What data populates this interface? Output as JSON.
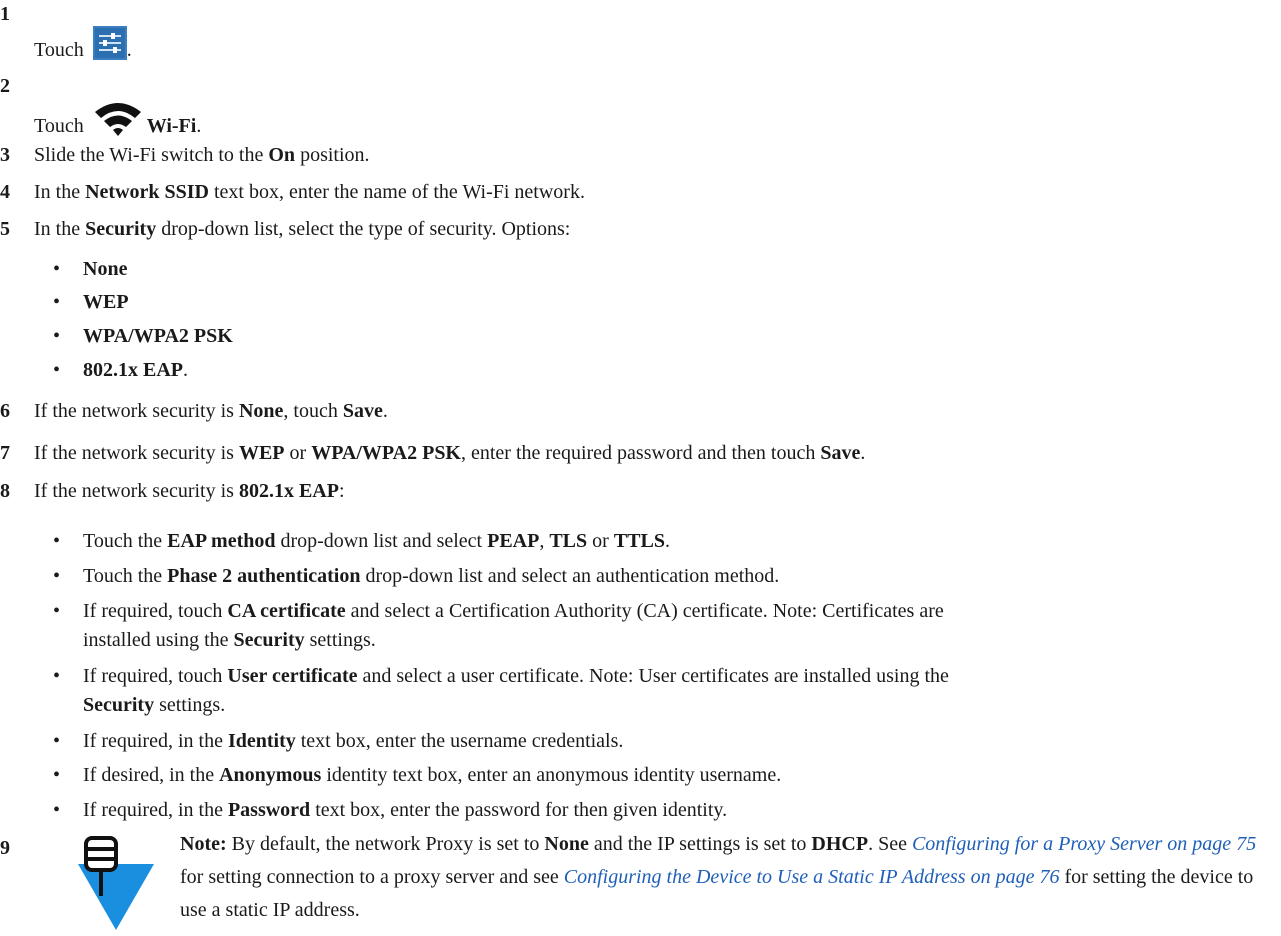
{
  "steps": [
    {
      "num": "1",
      "pre": "Touch",
      "post": ".",
      "icon": "settings-icon"
    },
    {
      "num": "2",
      "pre": "Touch",
      "bold": "Wi-Fi",
      "post": ".",
      "icon": "wifi-icon"
    },
    {
      "num": "3",
      "parts": [
        "Slide the Wi-Fi switch to the ",
        "On",
        " position."
      ]
    },
    {
      "num": "4",
      "parts": [
        "In the ",
        "Network SSID",
        " text box, enter the name of the Wi-Fi network."
      ]
    },
    {
      "num": "5",
      "parts": [
        "In the ",
        "Security",
        " drop-down list, select the type of security. Options:"
      ]
    },
    {
      "num": "6",
      "parts": [
        "If the network security is ",
        "None",
        ", touch ",
        "Save",
        "."
      ]
    },
    {
      "num": "7",
      "parts": [
        "If the network security is ",
        "WEP",
        " or ",
        "WPA/WPA2 PSK",
        ", enter the required password and then touch ",
        "Save",
        "."
      ]
    },
    {
      "num": "8",
      "parts": [
        "If the network security is ",
        "802.1x EAP",
        ":"
      ]
    },
    {
      "num": "9"
    }
  ],
  "security_options": [
    "None",
    "WEP",
    "WPA/WPA2 PSK",
    "802.1x EAP"
  ],
  "security_options_last_suffix": ".",
  "eap_bullets": [
    {
      "l1": [
        "Touch the ",
        "EAP method",
        " drop-down list and select ",
        "PEAP",
        ", ",
        "TLS",
        " or ",
        "TTLS",
        "."
      ]
    },
    {
      "l1": [
        "Touch the ",
        "Phase 2 authentication",
        " drop-down list and select an authentication method."
      ]
    },
    {
      "l1": [
        "If required, touch ",
        "CA certificate",
        " and select a Certification Authority (CA) certificate. Note: Certificates are"
      ],
      "l2": [
        "installed using the ",
        "Security",
        " settings."
      ]
    },
    {
      "l1": [
        "If required, touch ",
        "User certificate",
        " and select a user certificate. Note: User certificates are installed using the"
      ],
      "l2": [
        "",
        "Security",
        " settings."
      ]
    },
    {
      "l1": [
        "If required, in the ",
        "Identity",
        " text box, enter the username credentials."
      ]
    },
    {
      "l1": [
        "If desired, in the ",
        "Anonymous",
        " identity text box, enter an anonymous identity username."
      ]
    },
    {
      "l1": [
        "If required, in the ",
        "Password",
        " text box, enter the password for then given identity."
      ]
    }
  ],
  "bullet_char": "•",
  "note": {
    "label": "Note:",
    "t1": " By default, the network Proxy is set to ",
    "b1": "None",
    "t2": " and the IP settings is set to ",
    "b2": "DHCP",
    "t3": ". See ",
    "link1": "Configuring for a Proxy Server on page 75",
    "t4": " for setting connection to a proxy server and see ",
    "link2": "Configuring the Device to Use a Static IP Address on page 76",
    "t5": " for setting the device to use a static IP address."
  },
  "colors": {
    "link": "#1f5fb8",
    "note_icon": "#1a8fe0",
    "settings_icon_bg": "#2c6fb0"
  }
}
